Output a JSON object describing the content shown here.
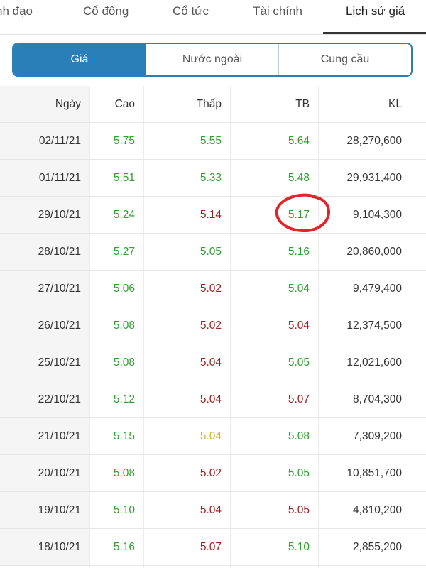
{
  "tabs": [
    {
      "label": "nh đạo",
      "active": false
    },
    {
      "label": "Cổ đông",
      "active": false
    },
    {
      "label": "Cổ tức",
      "active": false
    },
    {
      "label": "Tài chính",
      "active": false
    },
    {
      "label": "Lịch sử giá",
      "active": true
    }
  ],
  "segments": [
    {
      "label": "Giá",
      "active": true
    },
    {
      "label": "Nước ngoài",
      "active": false
    },
    {
      "label": "Cung cầu",
      "active": false
    }
  ],
  "table": {
    "headers": [
      "Ngày",
      "Cao",
      "Thấp",
      "TB",
      "KL"
    ],
    "rows": [
      {
        "date": "02/11/21",
        "cao": "5.75",
        "thap": "5.55",
        "tb": "5.64",
        "kl": "28,270,600",
        "cao_c": "green",
        "thap_c": "green",
        "tb_c": "green"
      },
      {
        "date": "01/11/21",
        "cao": "5.51",
        "thap": "5.33",
        "tb": "5.48",
        "kl": "29,931,400",
        "cao_c": "green",
        "thap_c": "green",
        "tb_c": "green"
      },
      {
        "date": "29/10/21",
        "cao": "5.24",
        "thap": "5.14",
        "tb": "5.17",
        "kl": "9,104,300",
        "cao_c": "green",
        "thap_c": "red",
        "tb_c": "green"
      },
      {
        "date": "28/10/21",
        "cao": "5.27",
        "thap": "5.05",
        "tb": "5.16",
        "kl": "20,860,000",
        "cao_c": "green",
        "thap_c": "green",
        "tb_c": "green"
      },
      {
        "date": "27/10/21",
        "cao": "5.06",
        "thap": "5.02",
        "tb": "5.04",
        "kl": "9,479,400",
        "cao_c": "green",
        "thap_c": "red",
        "tb_c": "green"
      },
      {
        "date": "26/10/21",
        "cao": "5.08",
        "thap": "5.02",
        "tb": "5.04",
        "kl": "12,374,500",
        "cao_c": "green",
        "thap_c": "red",
        "tb_c": "red"
      },
      {
        "date": "25/10/21",
        "cao": "5.08",
        "thap": "5.04",
        "tb": "5.05",
        "kl": "12,021,600",
        "cao_c": "green",
        "thap_c": "red",
        "tb_c": "green"
      },
      {
        "date": "22/10/21",
        "cao": "5.12",
        "thap": "5.04",
        "tb": "5.07",
        "kl": "8,704,300",
        "cao_c": "green",
        "thap_c": "red",
        "tb_c": "red"
      },
      {
        "date": "21/10/21",
        "cao": "5.15",
        "thap": "5.04",
        "tb": "5.08",
        "kl": "7,309,200",
        "cao_c": "green",
        "thap_c": "yellow",
        "tb_c": "green"
      },
      {
        "date": "20/10/21",
        "cao": "5.08",
        "thap": "5.02",
        "tb": "5.05",
        "kl": "10,851,700",
        "cao_c": "green",
        "thap_c": "red",
        "tb_c": "green"
      },
      {
        "date": "19/10/21",
        "cao": "5.10",
        "thap": "5.04",
        "tb": "5.05",
        "kl": "4,810,200",
        "cao_c": "green",
        "thap_c": "red",
        "tb_c": "red"
      },
      {
        "date": "18/10/21",
        "cao": "5.16",
        "thap": "5.07",
        "tb": "5.10",
        "kl": "2,855,200",
        "cao_c": "green",
        "thap_c": "red",
        "tb_c": "green"
      }
    ]
  },
  "colors": {
    "accent": "#2a7fb8",
    "up": "#2ea12e",
    "down": "#a41f1f",
    "reference": "#d7b526",
    "annotation": "#e0262a"
  }
}
